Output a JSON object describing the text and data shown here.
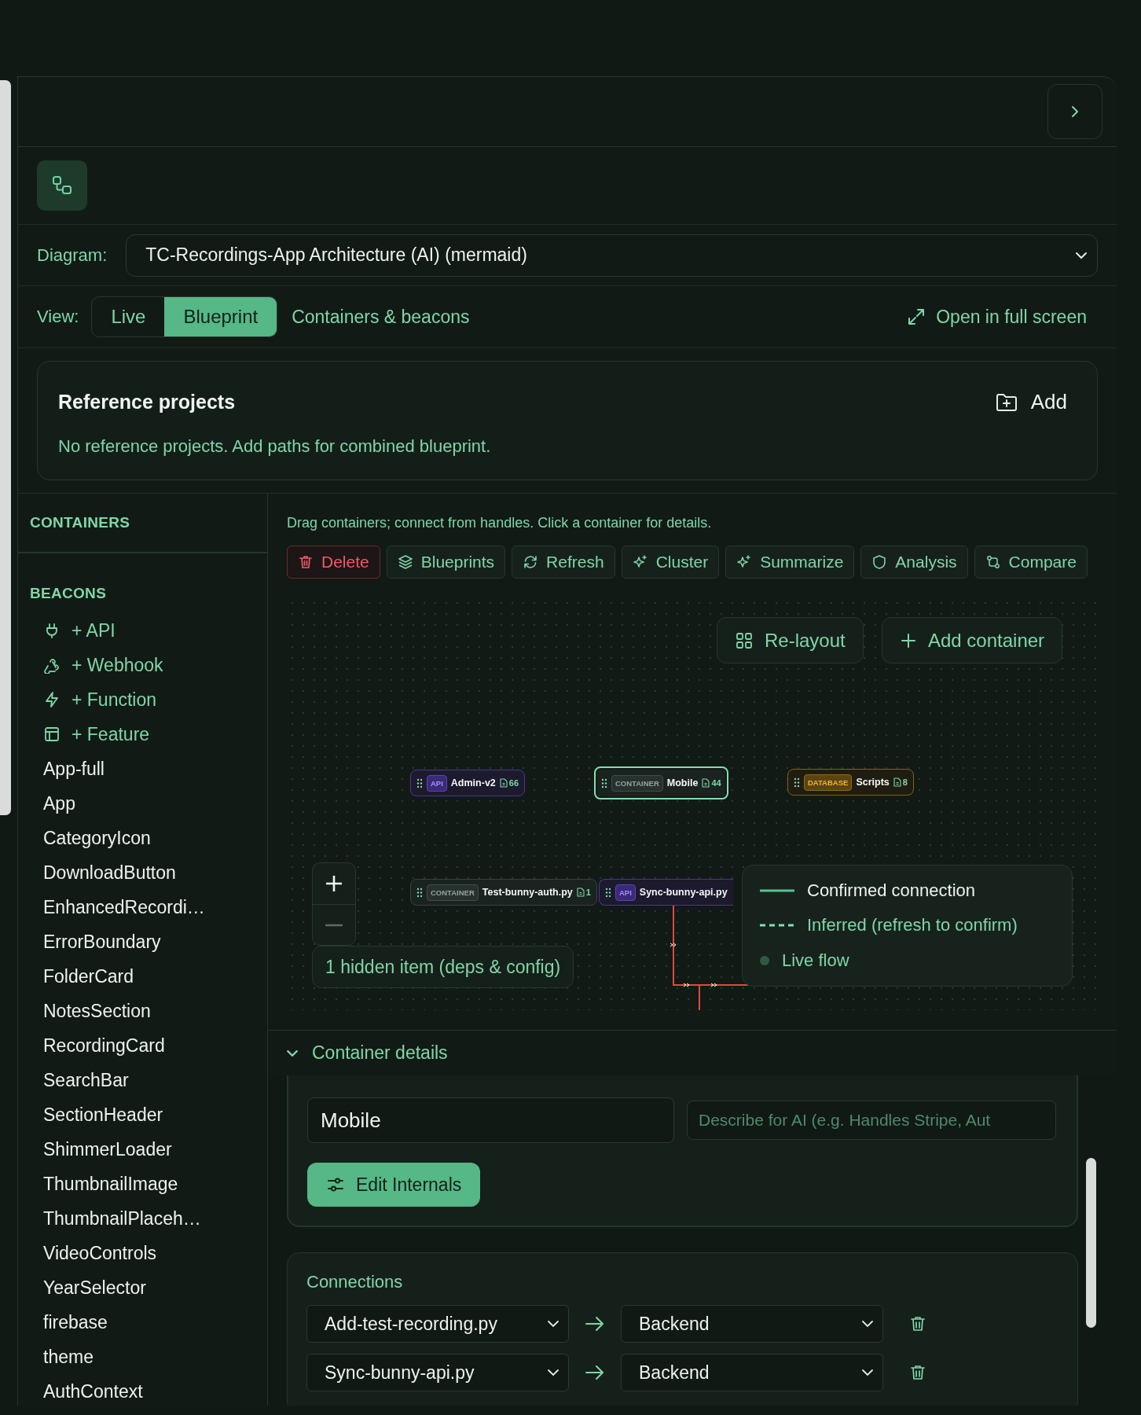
{
  "diagram": {
    "label": "Diagram:",
    "value": "TC-Recordings-App Architecture (AI) (mermaid)"
  },
  "view": {
    "label": "View:",
    "options": [
      {
        "label": "Live",
        "selected": false
      },
      {
        "label": "Blueprint",
        "selected": true
      }
    ],
    "link": "Containers & beacons",
    "fullscreen": "Open in full screen"
  },
  "reference_projects": {
    "title": "Reference projects",
    "add": "Add",
    "empty": "No reference projects. Add paths for combined blueprint."
  },
  "sidebar": {
    "containers_heading": "CONTAINERS",
    "beacons_heading": "BEACONS",
    "items": [
      {
        "label": "+ API",
        "kind": "action"
      },
      {
        "label": "+ Webhook",
        "kind": "action"
      },
      {
        "label": "+ Function",
        "kind": "action"
      },
      {
        "label": "+ Feature",
        "kind": "action"
      },
      {
        "label": "App-full",
        "kind": "file"
      },
      {
        "label": "App",
        "kind": "file"
      },
      {
        "label": "CategoryIcon",
        "kind": "file"
      },
      {
        "label": "DownloadButton",
        "kind": "file"
      },
      {
        "label": "EnhancedRecordi…",
        "kind": "file"
      },
      {
        "label": "ErrorBoundary",
        "kind": "file"
      },
      {
        "label": "FolderCard",
        "kind": "file"
      },
      {
        "label": "NotesSection",
        "kind": "file"
      },
      {
        "label": "RecordingCard",
        "kind": "file"
      },
      {
        "label": "SearchBar",
        "kind": "file"
      },
      {
        "label": "SectionHeader",
        "kind": "file"
      },
      {
        "label": "ShimmerLoader",
        "kind": "file"
      },
      {
        "label": "ThumbnailImage",
        "kind": "file"
      },
      {
        "label": "ThumbnailPlaceh…",
        "kind": "file"
      },
      {
        "label": "VideoControls",
        "kind": "file"
      },
      {
        "label": "YearSelector",
        "kind": "file"
      },
      {
        "label": "firebase",
        "kind": "file"
      },
      {
        "label": "theme",
        "kind": "file"
      },
      {
        "label": "AuthContext",
        "kind": "file"
      }
    ]
  },
  "canvas": {
    "hint": "Drag containers; connect from handles. Click a container for details.",
    "toolbar": [
      {
        "label": "Delete",
        "kind": "danger"
      },
      {
        "label": "Blueprints",
        "kind": "normal"
      },
      {
        "label": "Refresh",
        "kind": "normal"
      },
      {
        "label": "Cluster",
        "kind": "normal"
      },
      {
        "label": "Summarize",
        "kind": "normal"
      },
      {
        "label": "Analysis",
        "kind": "normal"
      },
      {
        "label": "Compare",
        "kind": "normal"
      }
    ],
    "relayout": "Re-layout",
    "add_container": "Add container",
    "nodes": [
      {
        "type": "API",
        "name": "Admin-v2",
        "count": "66",
        "selected": false
      },
      {
        "type": "CONTAINER",
        "name": "Mobile",
        "count": "44",
        "selected": true
      },
      {
        "type": "DATABASE",
        "name": "Scripts",
        "count": "8",
        "selected": false
      },
      {
        "type": "CONTAINER",
        "name": "Test-bunny-auth.py",
        "count": "1",
        "selected": false
      },
      {
        "type": "API",
        "name": "Sync-bunny-api.py",
        "selected": false
      }
    ],
    "hidden_items": "1 hidden item (deps & config)",
    "legend": [
      {
        "kind": "solid",
        "label": "Confirmed connection"
      },
      {
        "kind": "dashed",
        "label": "Inferred (refresh to confirm)"
      },
      {
        "kind": "dot",
        "label": "Live flow"
      }
    ]
  },
  "container_details": {
    "title": "Container details",
    "expanded": true,
    "name_value": "Mobile",
    "description_placeholder": "Describe for AI (e.g. Handles Stripe, Aut",
    "edit_button": "Edit Internals"
  },
  "connections": {
    "title": "Connections",
    "rows": [
      {
        "from": "Add-test-recording.py",
        "to": "Backend"
      },
      {
        "from": "Sync-bunny-api.py",
        "to": "Backend"
      }
    ]
  }
}
